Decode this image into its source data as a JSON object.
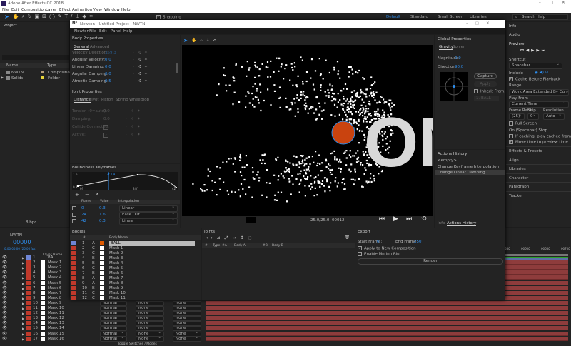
{
  "app": {
    "title": "Adobe After Effects CC 2018",
    "menu": [
      "File",
      "Edit",
      "Composition",
      "Layer",
      "Effect",
      "Animation",
      "View",
      "Window",
      "Help"
    ],
    "snapping": "Snapping",
    "workspaces": [
      "Default",
      "Standard",
      "Small Screen",
      "Libraries"
    ],
    "search": "Search Help"
  },
  "project": {
    "title": "Project",
    "columns": {
      "name": "Name",
      "type": "Type"
    },
    "items": [
      {
        "name": "NWTN",
        "type": "Composition",
        "color": "#b59d7a"
      },
      {
        "name": "Solids",
        "type": "Folder",
        "color": "#e8d43a"
      }
    ],
    "bpc": "8 bpc"
  },
  "newton": {
    "title": "Newton - Untitled Project - NWTN",
    "menu": [
      "Newton",
      "File",
      "Edit",
      "Panel",
      "Help"
    ]
  },
  "body_props": {
    "title": "Body Properties",
    "tabs": [
      "General",
      "Advanced"
    ],
    "rows": [
      {
        "label": "Velocity Direction:",
        "value": "359.3"
      },
      {
        "label": "Angular Velocity:",
        "value": "0.0"
      },
      {
        "label": "Linear Damping:",
        "value": "0.0"
      },
      {
        "label": "Angular Damping:",
        "value": "0.0"
      },
      {
        "label": "Atmetic Damping:",
        "value": "0.5"
      }
    ]
  },
  "joint_props": {
    "title": "Joint Properties",
    "tabs": [
      "Distance",
      "Pivot",
      "Piston",
      "Spring",
      "Wheel",
      "Blob"
    ],
    "rows": [
      {
        "label": "Tension (0=auto):",
        "value": "0.0"
      },
      {
        "label": "Damping:",
        "value": "0.0"
      },
      {
        "label": "Collide Connected:",
        "value": "✓"
      },
      {
        "label": "Active:",
        "value": "✓"
      }
    ]
  },
  "keyframes": {
    "title": "Bounciness Keyframes",
    "ymax": "1.6",
    "ymin": "0.3",
    "marker": "17f 0.9",
    "xlabels": [
      "0f",
      "24f",
      "42f"
    ],
    "columns": [
      "Frame",
      "Value",
      "Interpolation"
    ],
    "rows": [
      {
        "frame": "0",
        "value": "0.3",
        "interp": "Linear"
      },
      {
        "frame": "24",
        "value": "1.6",
        "interp": "Ease Out"
      },
      {
        "frame": "42",
        "value": "0.3",
        "interp": "Linear"
      }
    ]
  },
  "viewer": {
    "fps": "25.0/25.0",
    "frame": "00012",
    "text": "ON",
    "ball_color": "#c9430f"
  },
  "global_props": {
    "title": "Global Properties",
    "tabs": [
      "Gravity",
      "Solver"
    ],
    "magnitude_label": "Magnitude:",
    "magnitude": "0.0",
    "direction_label": "Direction:",
    "direction": "90.0",
    "capture": "Capture",
    "apply": "Apply",
    "inherit": "Inherit From:",
    "inherit_value": "1. BALL"
  },
  "history": {
    "title": "Actions History",
    "items": [
      "<empty>",
      "Change Keyframe Interpolation",
      "Change Linear Damping"
    ],
    "tabs": [
      "Info",
      "Actions History"
    ]
  },
  "right": {
    "info": "Info",
    "audio": "Audio",
    "preview": "Preview",
    "shortcut_label": "Shortcut",
    "shortcut": "Spacebar",
    "include": "Include",
    "cache": "Cache Before Playback",
    "range_label": "Range",
    "range": "Work Area Extended By Current...",
    "play_from_label": "Play From",
    "play_from": "Current Time",
    "fr_label": "Frame Rate",
    "skip_label": "Skip",
    "res_label": "Resolution",
    "fr": "(25)",
    "skip": "0",
    "res": "Auto",
    "full_screen": "Full Screen",
    "on_stop": "On (Spacebar) Stop",
    "if_caching": "If caching, play cached frames",
    "move_time": "Move time to preview time",
    "panels": [
      "Effects & Presets",
      "Align",
      "Libraries",
      "Character",
      "Paragraph",
      "Tracker"
    ]
  },
  "timeline": {
    "comp": "NWTN",
    "timecode": "00000",
    "fps": "0:00:00:00 (25.00 fps)",
    "layer_col": "Layer Name",
    "ruler": [
      "00550",
      "00600",
      "00650",
      "00700"
    ],
    "mode": "Normal",
    "none": "None",
    "toggle": "Toggle Switches / Modes",
    "layers": [
      "BALL",
      "Mask 1",
      "Mask 2",
      "Mask 3",
      "Mask 4",
      "Mask 5",
      "Mask 6",
      "Mask 7",
      "Mask 8",
      "Mask 9",
      "Mask 10",
      "Mask 11",
      "Mask 12",
      "Mask 13",
      "Mask 14",
      "Mask 15",
      "Mask 16"
    ]
  },
  "bodies": {
    "title": "Bodies",
    "col_num": "#",
    "col_name": "Body Name",
    "rows": [
      [
        "1",
        "A",
        "BALL"
      ],
      [
        "2",
        "C",
        "Mask 1"
      ],
      [
        "3",
        "C",
        "Mask 2"
      ],
      [
        "4",
        "B",
        "Mask 3"
      ],
      [
        "5",
        "B",
        "Mask 4"
      ],
      [
        "6",
        "C",
        "Mask 5"
      ],
      [
        "7",
        "B",
        "Mask 6"
      ],
      [
        "8",
        "A",
        "Mask 7"
      ],
      [
        "9",
        "A",
        "Mask 8"
      ],
      [
        "10",
        "B",
        "Mask 9"
      ],
      [
        "11",
        "C",
        "Mask 10"
      ],
      [
        "12",
        "C",
        "Mask 11"
      ]
    ]
  },
  "joints": {
    "title": "Joints",
    "columns": [
      "#",
      "Type",
      "#A",
      "Body A",
      "#B",
      "Body B"
    ]
  },
  "export": {
    "title": "Export",
    "start_label": "Start Frame:",
    "start": "0",
    "end_label": "End Frame:",
    "end": "250",
    "apply": "Apply to New Composition",
    "blur": "Enable Motion Blur",
    "render": "Render"
  }
}
